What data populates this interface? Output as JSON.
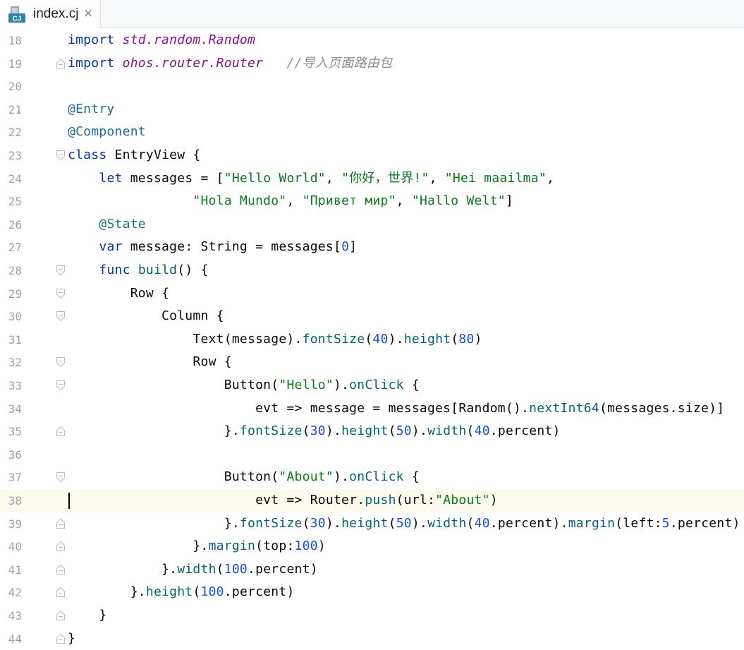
{
  "tab": {
    "icon_name": "cangjie-file-icon",
    "icon_text": "CJ",
    "label": "index.cj",
    "close_glyph": "×"
  },
  "editor": {
    "current_line": 38,
    "colors": {
      "keyword": "#0033b3",
      "annotation": "#1f6e8c",
      "string": "#067d17",
      "number": "#1750eb",
      "function": "#00627a",
      "import_path": "#871094",
      "comment": "#8c8c8c",
      "current_line_bg": "#fcfaed"
    },
    "lines": [
      {
        "num": "18",
        "fold": "",
        "tokens": [
          [
            "kw",
            "import"
          ],
          [
            "pl",
            " "
          ],
          [
            "ns",
            "std.random.Random"
          ]
        ]
      },
      {
        "num": "19",
        "fold": "end",
        "tokens": [
          [
            "kw",
            "import"
          ],
          [
            "pl",
            " "
          ],
          [
            "ns",
            "ohos.router.Router"
          ],
          [
            "pl",
            "   "
          ],
          [
            "cm",
            "//导入页面路由包"
          ]
        ]
      },
      {
        "num": "20",
        "fold": "",
        "tokens": []
      },
      {
        "num": "21",
        "fold": "",
        "tokens": [
          [
            "an",
            "@Entry"
          ]
        ]
      },
      {
        "num": "22",
        "fold": "",
        "tokens": [
          [
            "an",
            "@Component"
          ]
        ]
      },
      {
        "num": "23",
        "fold": "start",
        "tokens": [
          [
            "kw",
            "class"
          ],
          [
            "pl",
            " EntryView {"
          ]
        ]
      },
      {
        "num": "24",
        "fold": "",
        "tokens": [
          [
            "pl",
            "    "
          ],
          [
            "kw",
            "let"
          ],
          [
            "pl",
            " messages = ["
          ],
          [
            "st",
            "\"Hello World\""
          ],
          [
            "pl",
            ", "
          ],
          [
            "st",
            "\"你好，世界!\""
          ],
          [
            "pl",
            ", "
          ],
          [
            "st",
            "\"Hei maailma\""
          ],
          [
            "pl",
            ","
          ]
        ]
      },
      {
        "num": "25",
        "fold": "",
        "tokens": [
          [
            "pl",
            "                "
          ],
          [
            "st",
            "\"Hola Mundo\""
          ],
          [
            "pl",
            ", "
          ],
          [
            "st",
            "\"Привет мир\""
          ],
          [
            "pl",
            ", "
          ],
          [
            "st",
            "\"Hallo Welt\""
          ],
          [
            "pl",
            "]"
          ]
        ]
      },
      {
        "num": "26",
        "fold": "",
        "tokens": [
          [
            "pl",
            "    "
          ],
          [
            "an",
            "@State"
          ]
        ]
      },
      {
        "num": "27",
        "fold": "",
        "tokens": [
          [
            "pl",
            "    "
          ],
          [
            "kw",
            "var"
          ],
          [
            "pl",
            " message: String = messages["
          ],
          [
            "nu",
            "0"
          ],
          [
            "pl",
            "]"
          ]
        ]
      },
      {
        "num": "28",
        "fold": "start",
        "tokens": [
          [
            "pl",
            "    "
          ],
          [
            "kw",
            "func"
          ],
          [
            "pl",
            " "
          ],
          [
            "fn",
            "build"
          ],
          [
            "pl",
            "() {"
          ]
        ]
      },
      {
        "num": "29",
        "fold": "start",
        "tokens": [
          [
            "pl",
            "        Row {"
          ]
        ]
      },
      {
        "num": "30",
        "fold": "start",
        "tokens": [
          [
            "pl",
            "            Column {"
          ]
        ]
      },
      {
        "num": "31",
        "fold": "",
        "tokens": [
          [
            "pl",
            "                Text(message)."
          ],
          [
            "fn",
            "fontSize"
          ],
          [
            "pl",
            "("
          ],
          [
            "nu",
            "40"
          ],
          [
            "pl",
            ")."
          ],
          [
            "fn",
            "height"
          ],
          [
            "pl",
            "("
          ],
          [
            "nu",
            "80"
          ],
          [
            "pl",
            ")"
          ]
        ]
      },
      {
        "num": "32",
        "fold": "start",
        "tokens": [
          [
            "pl",
            "                Row {"
          ]
        ]
      },
      {
        "num": "33",
        "fold": "start",
        "tokens": [
          [
            "pl",
            "                    Button("
          ],
          [
            "st",
            "\"Hello\""
          ],
          [
            "pl",
            ")."
          ],
          [
            "fn",
            "onClick"
          ],
          [
            "pl",
            " {"
          ]
        ]
      },
      {
        "num": "34",
        "fold": "",
        "tokens": [
          [
            "pl",
            "                        evt => message = messages[Random()."
          ],
          [
            "fn",
            "nextInt64"
          ],
          [
            "pl",
            "(messages.size)]"
          ]
        ]
      },
      {
        "num": "35",
        "fold": "end",
        "tokens": [
          [
            "pl",
            "                    }."
          ],
          [
            "fn",
            "fontSize"
          ],
          [
            "pl",
            "("
          ],
          [
            "nu",
            "30"
          ],
          [
            "pl",
            ")."
          ],
          [
            "fn",
            "height"
          ],
          [
            "pl",
            "("
          ],
          [
            "nu",
            "50"
          ],
          [
            "pl",
            ")."
          ],
          [
            "fn",
            "width"
          ],
          [
            "pl",
            "("
          ],
          [
            "nu",
            "40"
          ],
          [
            "pl",
            ".percent)"
          ]
        ]
      },
      {
        "num": "36",
        "fold": "",
        "tokens": []
      },
      {
        "num": "37",
        "fold": "start",
        "tokens": [
          [
            "pl",
            "                    Button("
          ],
          [
            "st",
            "\"About\""
          ],
          [
            "pl",
            ")."
          ],
          [
            "fn",
            "onClick"
          ],
          [
            "pl",
            " {"
          ]
        ]
      },
      {
        "num": "38",
        "fold": "",
        "tokens": [
          [
            "pl",
            "                        evt => Router."
          ],
          [
            "fn",
            "push"
          ],
          [
            "pl",
            "(url:"
          ],
          [
            "st",
            "\"About\""
          ],
          [
            "pl",
            ")"
          ]
        ]
      },
      {
        "num": "39",
        "fold": "end",
        "tokens": [
          [
            "pl",
            "                    }."
          ],
          [
            "fn",
            "fontSize"
          ],
          [
            "pl",
            "("
          ],
          [
            "nu",
            "30"
          ],
          [
            "pl",
            ")."
          ],
          [
            "fn",
            "height"
          ],
          [
            "pl",
            "("
          ],
          [
            "nu",
            "50"
          ],
          [
            "pl",
            ")."
          ],
          [
            "fn",
            "width"
          ],
          [
            "pl",
            "("
          ],
          [
            "nu",
            "40"
          ],
          [
            "pl",
            ".percent)."
          ],
          [
            "fn",
            "margin"
          ],
          [
            "pl",
            "(left:"
          ],
          [
            "nu",
            "5"
          ],
          [
            "pl",
            ".percent)"
          ]
        ]
      },
      {
        "num": "40",
        "fold": "end",
        "tokens": [
          [
            "pl",
            "                }."
          ],
          [
            "fn",
            "margin"
          ],
          [
            "pl",
            "(top:"
          ],
          [
            "nu",
            "100"
          ],
          [
            "pl",
            ")"
          ]
        ]
      },
      {
        "num": "41",
        "fold": "end",
        "tokens": [
          [
            "pl",
            "            }."
          ],
          [
            "fn",
            "width"
          ],
          [
            "pl",
            "("
          ],
          [
            "nu",
            "100"
          ],
          [
            "pl",
            ".percent)"
          ]
        ]
      },
      {
        "num": "42",
        "fold": "end",
        "tokens": [
          [
            "pl",
            "        }."
          ],
          [
            "fn",
            "height"
          ],
          [
            "pl",
            "("
          ],
          [
            "nu",
            "100"
          ],
          [
            "pl",
            ".percent)"
          ]
        ]
      },
      {
        "num": "43",
        "fold": "end",
        "tokens": [
          [
            "pl",
            "    }"
          ]
        ]
      },
      {
        "num": "44",
        "fold": "end",
        "tokens": [
          [
            "pl",
            "}"
          ]
        ]
      }
    ]
  }
}
